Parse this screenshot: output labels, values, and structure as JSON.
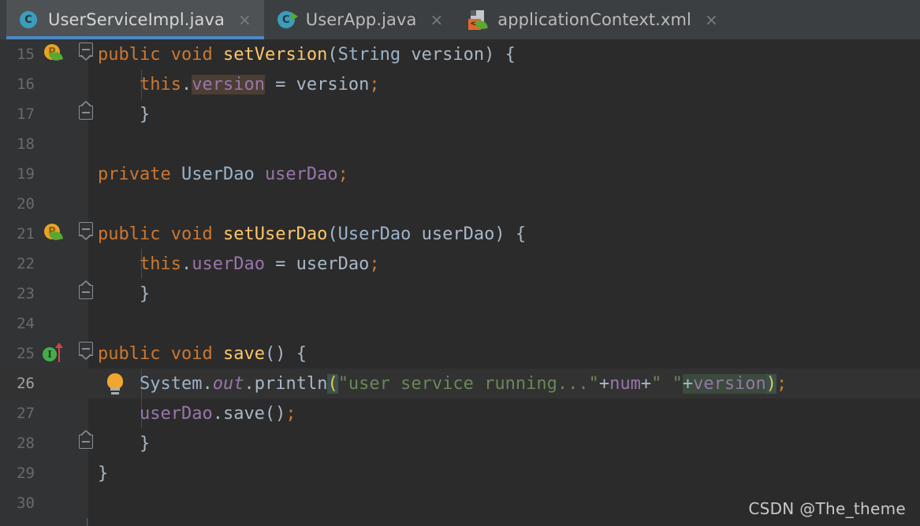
{
  "window": {
    "app": "IntelliJ IDEA Editor",
    "theme_background": "#2b2b2b",
    "accent_blue": "#4a88c7"
  },
  "tabs": [
    {
      "label": "UserServiceImpl.java",
      "icon": "java-class-icon",
      "selected": true,
      "close_glyph": "×"
    },
    {
      "label": "UserApp.java",
      "icon": "java-runnable-class-icon",
      "selected": false,
      "close_glyph": "×"
    },
    {
      "label": "applicationContext.xml",
      "icon": "spring-xml-config-icon",
      "selected": false,
      "close_glyph": "×"
    }
  ],
  "editor": {
    "first_line": 15,
    "current_line": 26,
    "lines": [
      {
        "number": "15",
        "gutter_icon": "spring-bean-property-icon",
        "fold": "start",
        "indent_guide": false,
        "tokens": [
          {
            "t": "public",
            "c": "kw"
          },
          {
            "t": " ",
            "c": "pln"
          },
          {
            "t": "void",
            "c": "kw"
          },
          {
            "t": " ",
            "c": "pln"
          },
          {
            "t": "setVersion",
            "c": "mth"
          },
          {
            "t": "(",
            "c": "punc"
          },
          {
            "t": "String",
            "c": "cls"
          },
          {
            "t": " version",
            "c": "pln"
          },
          {
            "t": ")",
            "c": "punc"
          },
          {
            "t": " {",
            "c": "pln"
          }
        ]
      },
      {
        "number": "16",
        "gutter_icon": null,
        "fold": null,
        "indent_guide": true,
        "tokens": [
          {
            "t": "    ",
            "c": "pln"
          },
          {
            "t": "this",
            "c": "kw"
          },
          {
            "t": ".",
            "c": "pln"
          },
          {
            "t": "version",
            "c": "fld hl-field"
          },
          {
            "t": " = version",
            "c": "pln"
          },
          {
            "t": ";",
            "c": "semi"
          }
        ]
      },
      {
        "number": "17",
        "gutter_icon": null,
        "fold": "end",
        "indent_guide": false,
        "tokens": [
          {
            "t": "    }",
            "c": "pln"
          }
        ]
      },
      {
        "number": "18",
        "gutter_icon": null,
        "fold": null,
        "indent_guide": false,
        "tokens": []
      },
      {
        "number": "19",
        "gutter_icon": null,
        "fold": null,
        "indent_guide": false,
        "tokens": [
          {
            "t": "private",
            "c": "kw"
          },
          {
            "t": " ",
            "c": "pln"
          },
          {
            "t": "UserDao",
            "c": "cls"
          },
          {
            "t": " ",
            "c": "pln"
          },
          {
            "t": "userDao",
            "c": "fld"
          },
          {
            "t": ";",
            "c": "semi"
          }
        ]
      },
      {
        "number": "20",
        "gutter_icon": null,
        "fold": null,
        "indent_guide": false,
        "tokens": []
      },
      {
        "number": "21",
        "gutter_icon": "spring-bean-property-icon",
        "fold": "start",
        "indent_guide": false,
        "tokens": [
          {
            "t": "public",
            "c": "kw"
          },
          {
            "t": " ",
            "c": "pln"
          },
          {
            "t": "void",
            "c": "kw"
          },
          {
            "t": " ",
            "c": "pln"
          },
          {
            "t": "setUserDao",
            "c": "mth"
          },
          {
            "t": "(",
            "c": "punc"
          },
          {
            "t": "UserDao",
            "c": "cls"
          },
          {
            "t": " userDao",
            "c": "pln"
          },
          {
            "t": ")",
            "c": "punc"
          },
          {
            "t": " {",
            "c": "pln"
          }
        ]
      },
      {
        "number": "22",
        "gutter_icon": null,
        "fold": null,
        "indent_guide": true,
        "tokens": [
          {
            "t": "    ",
            "c": "pln"
          },
          {
            "t": "this",
            "c": "kw"
          },
          {
            "t": ".",
            "c": "pln"
          },
          {
            "t": "userDao",
            "c": "fld"
          },
          {
            "t": " = userDao",
            "c": "pln"
          },
          {
            "t": ";",
            "c": "semi"
          }
        ]
      },
      {
        "number": "23",
        "gutter_icon": null,
        "fold": "end",
        "indent_guide": false,
        "tokens": [
          {
            "t": "    }",
            "c": "pln"
          }
        ]
      },
      {
        "number": "24",
        "gutter_icon": null,
        "fold": null,
        "indent_guide": false,
        "tokens": []
      },
      {
        "number": "25",
        "gutter_icon": "implementing-method-icon",
        "fold": "start",
        "indent_guide": false,
        "tokens": [
          {
            "t": "public",
            "c": "kw"
          },
          {
            "t": " ",
            "c": "pln"
          },
          {
            "t": "void",
            "c": "kw"
          },
          {
            "t": " ",
            "c": "pln"
          },
          {
            "t": "save",
            "c": "mth"
          },
          {
            "t": "()",
            "c": "punc"
          },
          {
            "t": " {",
            "c": "pln"
          }
        ]
      },
      {
        "number": "26",
        "gutter_icon": "intention-bulb-icon",
        "fold": null,
        "indent_guide": true,
        "current": true,
        "tokens": [
          {
            "t": "    ",
            "c": "pln"
          },
          {
            "t": "System",
            "c": "cls"
          },
          {
            "t": ".",
            "c": "pln"
          },
          {
            "t": "out",
            "c": "stat"
          },
          {
            "t": ".",
            "c": "pln"
          },
          {
            "t": "println",
            "c": "pln"
          },
          {
            "t": "(",
            "c": "brkt hl-brkt"
          },
          {
            "t": "\"user service running...\"",
            "c": "str"
          },
          {
            "t": "+",
            "c": "pln"
          },
          {
            "t": "num",
            "c": "fld"
          },
          {
            "t": "+",
            "c": "pln"
          },
          {
            "t": "\" \"",
            "c": "str"
          },
          {
            "t": "+",
            "c": "pln hl-ident"
          },
          {
            "t": "version",
            "c": "fld hl-ident"
          },
          {
            "t": ")",
            "c": "brkt hl-brkt"
          },
          {
            "t": ";",
            "c": "semi"
          }
        ]
      },
      {
        "number": "27",
        "gutter_icon": null,
        "fold": null,
        "indent_guide": true,
        "tokens": [
          {
            "t": "    ",
            "c": "pln"
          },
          {
            "t": "userDao",
            "c": "fld"
          },
          {
            "t": ".save()",
            "c": "pln"
          },
          {
            "t": ";",
            "c": "semi"
          }
        ]
      },
      {
        "number": "28",
        "gutter_icon": null,
        "fold": "end",
        "indent_guide": false,
        "tokens": [
          {
            "t": "    }",
            "c": "pln"
          }
        ]
      },
      {
        "number": "29",
        "gutter_icon": null,
        "fold": null,
        "indent_guide": false,
        "tokens": [
          {
            "t": "}",
            "c": "pln"
          }
        ]
      },
      {
        "number": "30",
        "gutter_icon": null,
        "fold": null,
        "indent_guide": false,
        "tokens": []
      }
    ]
  },
  "watermark": {
    "text": "CSDN @The_theme"
  }
}
